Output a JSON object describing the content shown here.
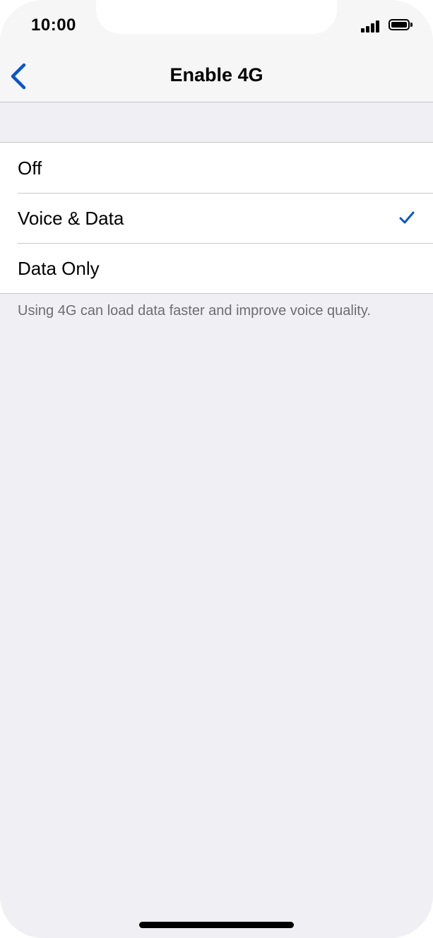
{
  "status_bar": {
    "time": "10:00",
    "signal_icon": "cellular-signal-icon",
    "battery_icon": "battery-icon"
  },
  "nav": {
    "title": "Enable 4G",
    "back_icon": "chevron-left-icon"
  },
  "options": [
    {
      "label": "Off",
      "selected": false
    },
    {
      "label": "Voice & Data",
      "selected": true
    },
    {
      "label": "Data Only",
      "selected": false
    }
  ],
  "footer_note": "Using 4G can load data faster and improve voice quality.",
  "colors": {
    "accent": "#0b56c7",
    "background": "#efeff4",
    "nav_background": "#f6f6f6",
    "separator": "#c8c7cc",
    "footer_text": "#6d6d72"
  }
}
